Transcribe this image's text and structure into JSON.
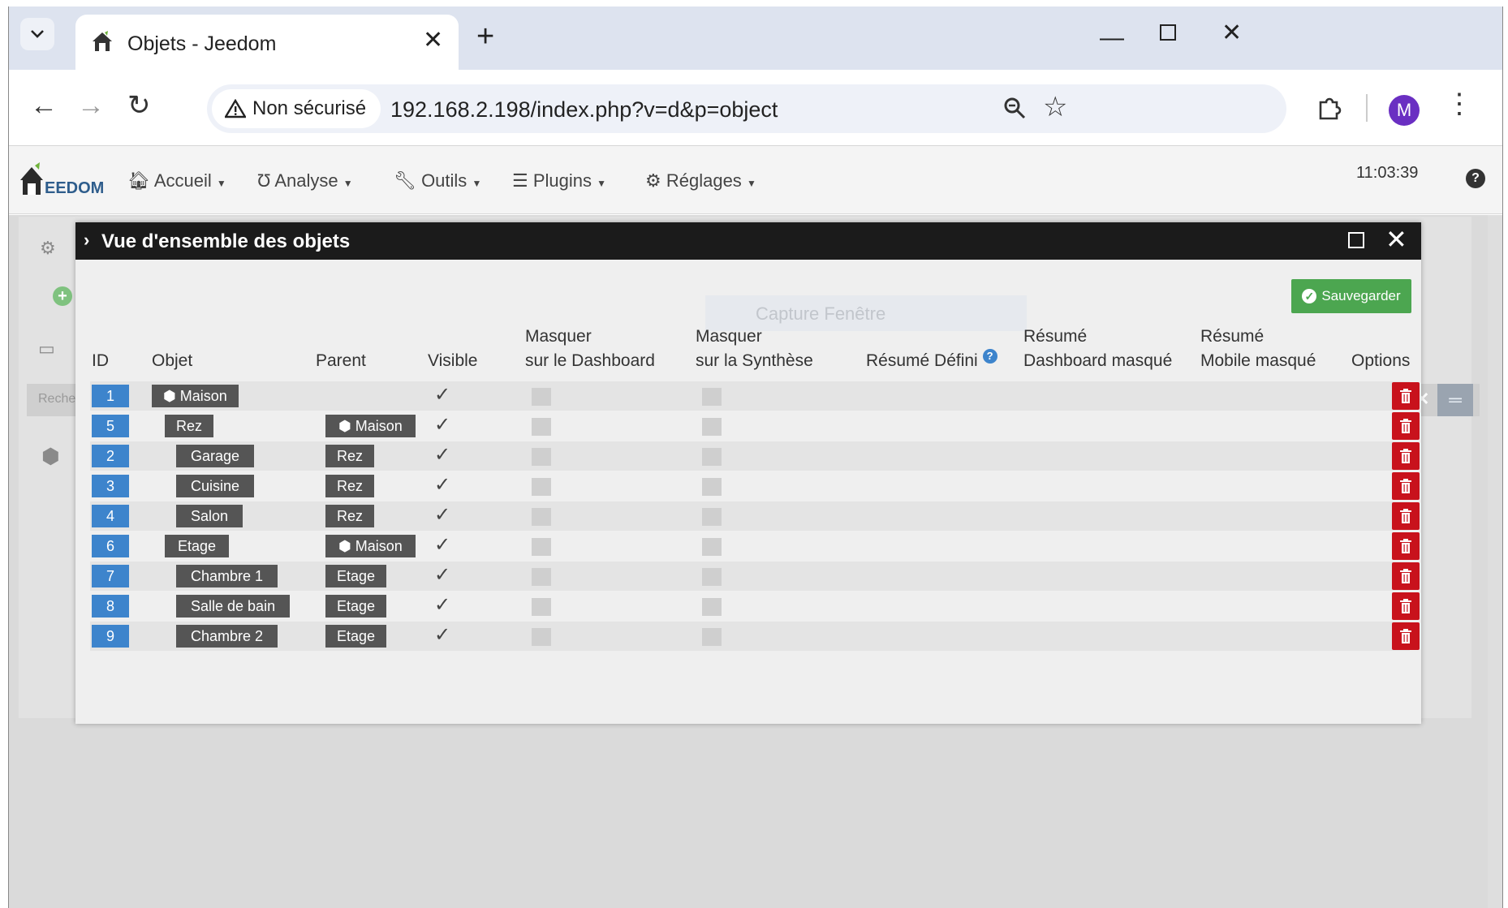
{
  "browser": {
    "tab_title": "Objets - Jeedom",
    "security_label": "Non sécurisé",
    "url": "192.168.2.198/index.php?v=d&p=object",
    "profile_initial": "M"
  },
  "jeedom_nav": {
    "menu": [
      "Accueil",
      "Analyse",
      "Outils",
      "Plugins",
      "Réglages"
    ],
    "clock": "11:03:39"
  },
  "background": {
    "search_placeholder": "Reche"
  },
  "modal": {
    "title": "Vue d'ensemble des objets",
    "save_label": "Sauvegarder",
    "ghost_text": "Capture Fenêtre",
    "headers": {
      "id": "ID",
      "objet": "Objet",
      "parent": "Parent",
      "visible": "Visible",
      "masquer_dash_1": "Masquer",
      "masquer_dash_2": "sur le Dashboard",
      "masquer_synth_1": "Masquer",
      "masquer_synth_2": "sur la Synthèse",
      "resume_defini": "Résumé Défini",
      "resume_dash_1": "Résumé",
      "resume_dash_2": "Dashboard masqué",
      "resume_mobile_1": "Résumé",
      "resume_mobile_2": "Mobile masqué",
      "options": "Options"
    },
    "rows": [
      {
        "id": "1",
        "objet": "Maison",
        "parent": ""
      },
      {
        "id": "5",
        "objet": "Rez",
        "parent": "Maison"
      },
      {
        "id": "2",
        "objet": "Garage",
        "parent": "Rez"
      },
      {
        "id": "3",
        "objet": "Cuisine",
        "parent": "Rez"
      },
      {
        "id": "4",
        "objet": "Salon",
        "parent": "Rez"
      },
      {
        "id": "6",
        "objet": "Etage",
        "parent": "Maison"
      },
      {
        "id": "7",
        "objet": "Chambre 1",
        "parent": "Etage"
      },
      {
        "id": "8",
        "objet": "Salle de bain",
        "parent": "Etage"
      },
      {
        "id": "9",
        "objet": "Chambre 2",
        "parent": "Etage"
      }
    ]
  }
}
